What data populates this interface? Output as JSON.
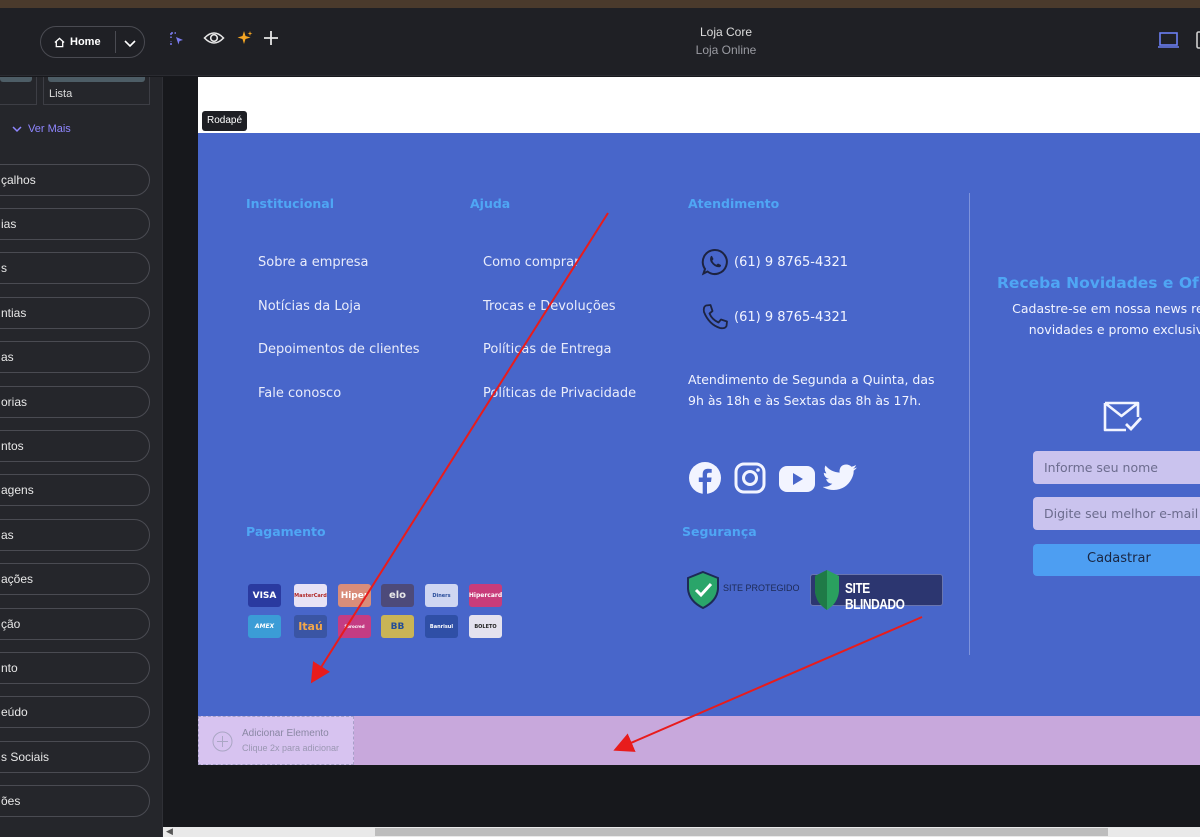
{
  "app": {
    "title": "Loja Core",
    "subtitle": "Loja Online"
  },
  "toolbar": {
    "page_label": "Home"
  },
  "sidebar": {
    "thumb_label": "Lista",
    "see_more": "Ver Mais",
    "items": [
      "çalhos",
      "ias",
      "s",
      "ntias",
      "as",
      "orias",
      "ntos",
      "agens",
      "as",
      "ações",
      "ção",
      "nto",
      "eúdo",
      "s Sociais",
      "ões"
    ]
  },
  "canvas": {
    "section_tag": "Rodapé",
    "footer": {
      "institucional": {
        "heading": "Institucional",
        "links": [
          "Sobre a empresa",
          "Notícias da Loja",
          "Depoimentos de clientes",
          "Fale conosco"
        ]
      },
      "ajuda": {
        "heading": "Ajuda",
        "links": [
          "Como comprar",
          "Trocas e Devoluções",
          "Políticas de Entrega",
          "Políticas de Privacidade"
        ]
      },
      "atendimento": {
        "heading": "Atendimento",
        "whatsapp": "(61) 9 8765-4321",
        "phone": "(61) 9 8765-4321",
        "hours": "Atendimento de Segunda a Quinta, das 9h às 18h e às Sextas das 8h às 17h."
      },
      "pagamento": {
        "heading": "Pagamento",
        "methods": [
          "VISA",
          "MasterCard",
          "Hiper",
          "elo",
          "Diners",
          "Hipercard",
          "AMEX",
          "Itaú",
          "Sorocred",
          "BB",
          "Banrisul",
          "BOLETO"
        ]
      },
      "seguranca": {
        "heading": "Segurança",
        "seal_site_protegido": "SITE PROTEGIDO",
        "seal_site_blindado": "SITE BLINDADO"
      },
      "newsletter": {
        "title": "Receba Novidades e Of",
        "subtitle": "Cadastre-se em nossa news receba novidades e promo exclusivas",
        "name_placeholder": "Informe seu nome",
        "email_placeholder": "Digite seu melhor e-mail",
        "button": "Cadastrar"
      }
    },
    "add_element": {
      "title": "Adicionar Elemento",
      "hint": "Clique 2x para adicionar"
    }
  },
  "colors": {
    "footer_bg": "#4866ca",
    "heading": "#4fa6f4",
    "arrow": "#e81c1c",
    "add_row": "#c8a8dc"
  }
}
